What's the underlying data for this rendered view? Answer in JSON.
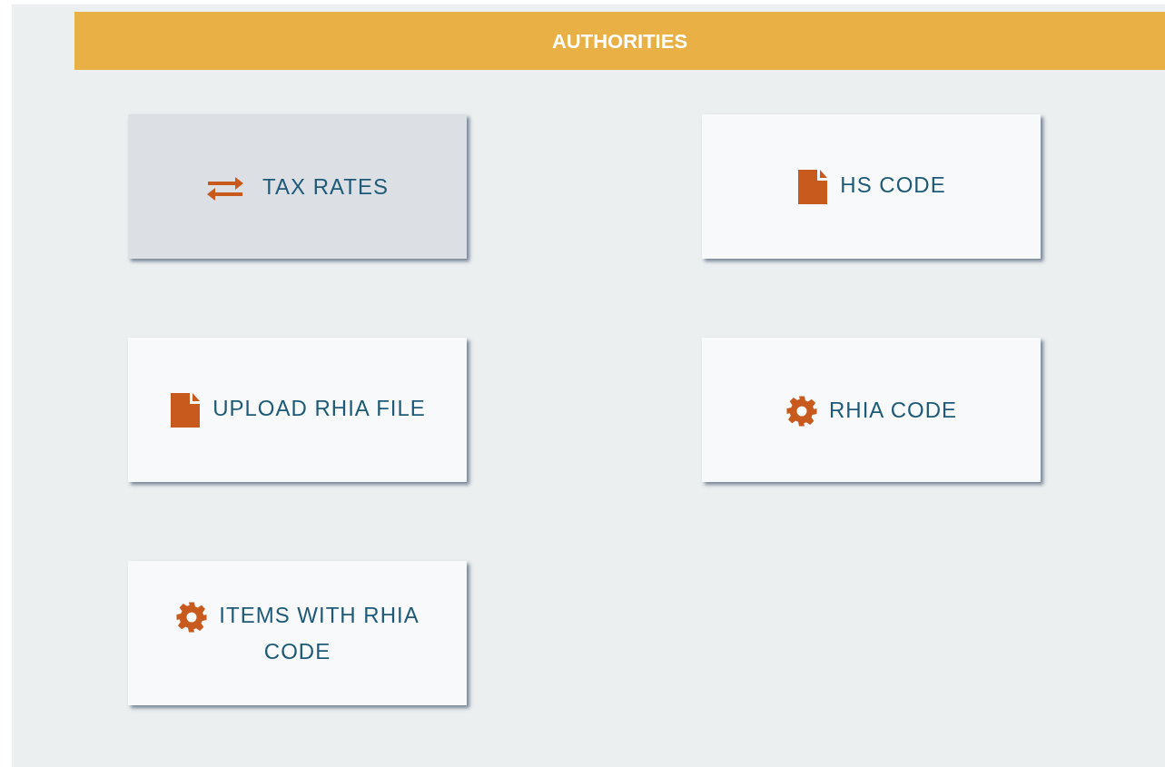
{
  "header": {
    "title": "AUTHORITIES"
  },
  "tiles": [
    {
      "label": "TAX RATES",
      "kind": "exchange",
      "selected": true
    },
    {
      "label": "HS CODE",
      "kind": "document",
      "selected": false
    },
    {
      "label": "UPLOAD RHIA FILE",
      "kind": "document",
      "selected": false
    },
    {
      "label": "RHIA CODE",
      "kind": "settings",
      "selected": false
    },
    {
      "label": "ITEMS WITH RHIA CODE",
      "kind": "settings",
      "selected": false
    }
  ]
}
